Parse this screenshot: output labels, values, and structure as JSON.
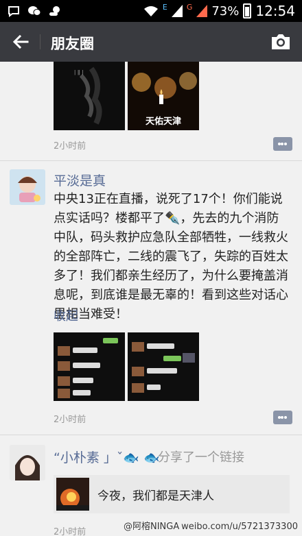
{
  "status_bar": {
    "battery_percent": "73%",
    "time": "12:54",
    "network_left": "E",
    "network_right": "G"
  },
  "app_bar": {
    "title": "朋友圈",
    "back_icon": "back-arrow-icon",
    "camera_icon": "camera-icon"
  },
  "posts": [
    {
      "thumbnails": [
        {
          "label": ""
        },
        {
          "label": "天佑天津"
        }
      ],
      "time": "2小时前"
    },
    {
      "name": "平淡是真",
      "text": "中央13正在直播，说死了17个！你们能说点实话吗？楼都平了✒️，先去的九个消防中队，码头救护应急队全部牺牲，一线救火的全部阵亡，二线的震飞了，失踪的百姓太多了！我们都亲生经历了，为什么要掩盖消息呢，到底谁是最无辜的！看到这些对话心里相当难受！",
      "collapse_label": "收起",
      "time": "2小时前"
    },
    {
      "name": "“小朴素 」ˇ🐟 🐟",
      "action": "分享了一个链接",
      "link_title": "今夜，我们都是天津人",
      "time": "2小时前"
    }
  ],
  "watermark": {
    "left": "@阿榕NINGA",
    "right": "weibo.com/u/5721373300"
  },
  "colors": {
    "app_bar": "#393a3f",
    "link_blue": "#576b95",
    "background": "#f1f1f1"
  }
}
